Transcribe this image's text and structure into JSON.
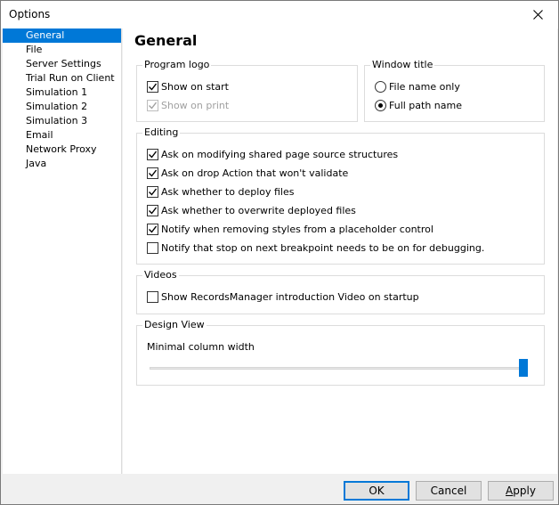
{
  "window": {
    "title": "Options"
  },
  "nav": {
    "items": [
      "General",
      "File",
      "Server Settings",
      "Trial Run on Client",
      "Simulation 1",
      "Simulation 2",
      "Simulation 3",
      "Email",
      "Network Proxy",
      "Java"
    ],
    "selected": "General"
  },
  "page": {
    "title": "General"
  },
  "program_logo": {
    "title": "Program logo",
    "show_on_start": {
      "label": "Show on start",
      "checked": true
    },
    "show_on_print": {
      "label": "Show on print",
      "checked": true,
      "disabled": true
    }
  },
  "window_title": {
    "title": "Window title",
    "options": [
      {
        "label": "File name only",
        "selected": false
      },
      {
        "label": "Full path name",
        "selected": true
      }
    ]
  },
  "editing": {
    "title": "Editing",
    "items": [
      {
        "label": "Ask on modifying shared page source structures",
        "checked": true
      },
      {
        "label": "Ask on drop Action that won't validate",
        "checked": true
      },
      {
        "label": "Ask whether to deploy files",
        "checked": true
      },
      {
        "label": "Ask whether to overwrite deployed files",
        "checked": true
      },
      {
        "label": "Notify when removing styles from a placeholder control",
        "checked": true
      },
      {
        "label": "Notify that stop on next breakpoint needs to be on for debugging.",
        "checked": false
      }
    ]
  },
  "videos": {
    "title": "Videos",
    "show_intro": {
      "label": "Show RecordsManager introduction Video on startup",
      "checked": false
    }
  },
  "design_view": {
    "title": "Design View",
    "slider_label": "Minimal column width",
    "slider_value_fraction": 1.0
  },
  "buttons": {
    "ok": "OK",
    "cancel": "Cancel",
    "apply_prefix": "",
    "apply_underlined": "A",
    "apply_rest": "pply"
  },
  "colors": {
    "accent": "#0078d7"
  }
}
